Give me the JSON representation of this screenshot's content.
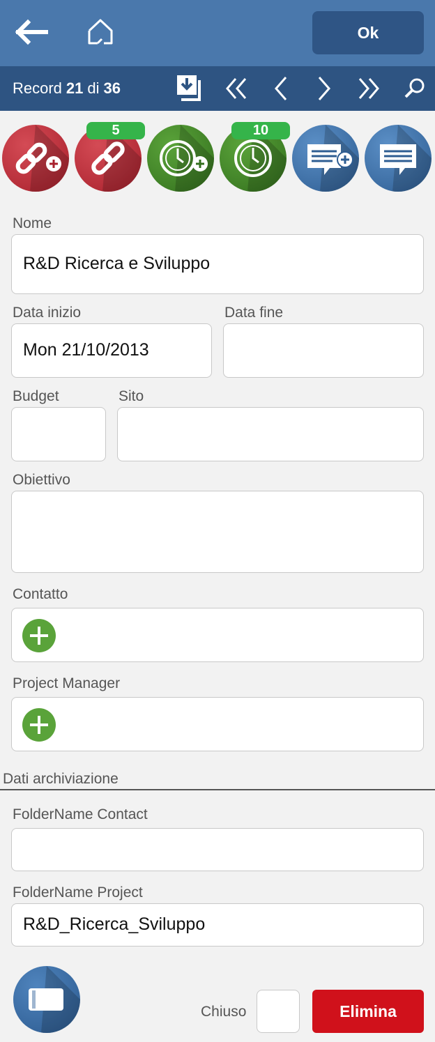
{
  "header": {
    "ok_label": "Ok"
  },
  "nav": {
    "record_prefix": "Record",
    "current": "21",
    "of_label": "di",
    "total": "36"
  },
  "badges": {
    "links_count": "5",
    "clocks_count": "10"
  },
  "form": {
    "nome": {
      "label": "Nome",
      "value": "R&D Ricerca e Sviluppo"
    },
    "data_inizio": {
      "label": "Data inizio",
      "value": "Mon 21/10/2013"
    },
    "data_fine": {
      "label": "Data fine",
      "value": ""
    },
    "budget": {
      "label": "Budget",
      "value": ""
    },
    "sito": {
      "label": "Sito",
      "value": ""
    },
    "obiettivo": {
      "label": "Obiettivo",
      "value": ""
    },
    "contatto": {
      "label": "Contatto"
    },
    "project_manager": {
      "label": "Project Manager"
    }
  },
  "archive": {
    "title": "Dati archiviazione",
    "folder_contact": {
      "label": "FolderName Contact",
      "value": ""
    },
    "folder_project": {
      "label": "FolderName Project",
      "value": "R&D_Ricerca_Sviluppo"
    }
  },
  "footer": {
    "chiuso_label": "Chiuso",
    "delete_label": "Elimina"
  },
  "colors": {
    "topbar": "#4a78ac",
    "navbar": "#2e5482",
    "ok_button": "#2f5585",
    "delete_button": "#d0111b",
    "badge": "#35b44a",
    "plus": "#5aa33a"
  },
  "icons": [
    "back-arrow-icon",
    "home-icon",
    "save-download-icon",
    "first-record-icon",
    "previous-record-icon",
    "next-record-icon",
    "last-record-icon",
    "search-icon",
    "add-link-icon",
    "links-icon",
    "add-time-icon",
    "time-entries-icon",
    "add-note-icon",
    "notes-icon",
    "add-contact-icon",
    "add-project-manager-icon",
    "tablet-icon"
  ]
}
